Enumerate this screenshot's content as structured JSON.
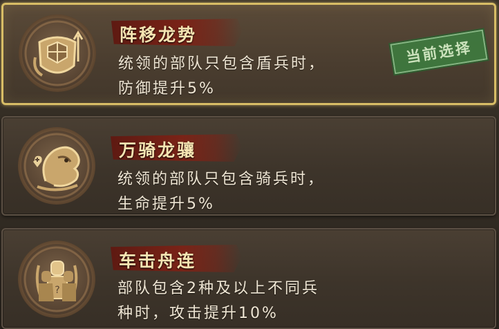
{
  "options": [
    {
      "title": "阵移龙势",
      "desc_line1": "统领的部队只包含盾兵时，",
      "desc_line2": "防御提升5%",
      "icon": "shield-turtle-icon",
      "selected": true,
      "badge": "当前选择"
    },
    {
      "title": "万骑龙骧",
      "desc_line1": "统领的部队只包含骑兵时，",
      "desc_line2": "生命提升5%",
      "icon": "dragon-heart-icon",
      "selected": false
    },
    {
      "title": "车击舟连",
      "desc_line1": "部队包含2种及以上不同兵",
      "desc_line2": "种时，攻击提升10%",
      "icon": "armored-soldiers-icon",
      "selected": false
    }
  ],
  "colors": {
    "selected_border": "#d8bd66",
    "title_banner": "#7a2317",
    "badge_green": "#3e7a3f",
    "text": "#efe6d4",
    "emblem_gold": "#e2c48a"
  }
}
